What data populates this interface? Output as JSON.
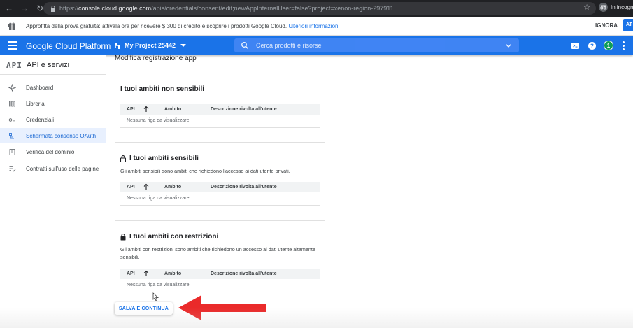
{
  "browser": {
    "url_prefix": "https://",
    "url_host": "console.cloud.google.com",
    "url_path": "/apis/credentials/consent/edit;newAppInternalUser=false?project=xenon-region-297911",
    "incognito_label": "In incogn"
  },
  "banner": {
    "text": "Approfitta della prova gratuita: attivala ora per ricevere $ 300 di credito e scoprire i prodotti Google Cloud.",
    "link": "Ulteriori informazioni",
    "dismiss": "IGNORA",
    "activate": "AT"
  },
  "header": {
    "title": "Google Cloud Platform",
    "project": "My Project 25442",
    "search_placeholder": "Cerca prodotti e risorse",
    "notification_count": "1",
    "accent": "#1a73e8"
  },
  "sidebar": {
    "logo": "API",
    "title": "API e servizi",
    "items": [
      {
        "label": "Dashboard",
        "icon": "dashboard-icon"
      },
      {
        "label": "Libreria",
        "icon": "library-icon"
      },
      {
        "label": "Credenziali",
        "icon": "key-icon"
      },
      {
        "label": "Schermata consenso OAuth",
        "icon": "consent-icon",
        "active": true
      },
      {
        "label": "Verifica del dominio",
        "icon": "domain-icon"
      },
      {
        "label": "Contratti sull'uso delle pagine",
        "icon": "agreements-icon"
      }
    ]
  },
  "main": {
    "title": "Modifica registrazione app",
    "columns": {
      "api": "API",
      "ambito": "Ambito",
      "descrizione": "Descrizione rivolta all'utente"
    },
    "empty_text": "Nessuna riga da visualizzare",
    "sections": [
      {
        "title": "I tuoi ambiti non sensibili",
        "description": ""
      },
      {
        "title": "I tuoi ambiti sensibili",
        "description": "Gli ambiti sensibili sono ambiti che richiedono l'accesso ai dati utente privati."
      },
      {
        "title": "I tuoi ambiti con restrizioni",
        "description": "Gli ambiti con restrizioni sono ambiti che richiedono un accesso ai dati utente altamente sensibili."
      }
    ],
    "save_button": "SALVA E CONTINUA"
  },
  "annotation": {
    "arrow_color": "#ea2a2a"
  }
}
